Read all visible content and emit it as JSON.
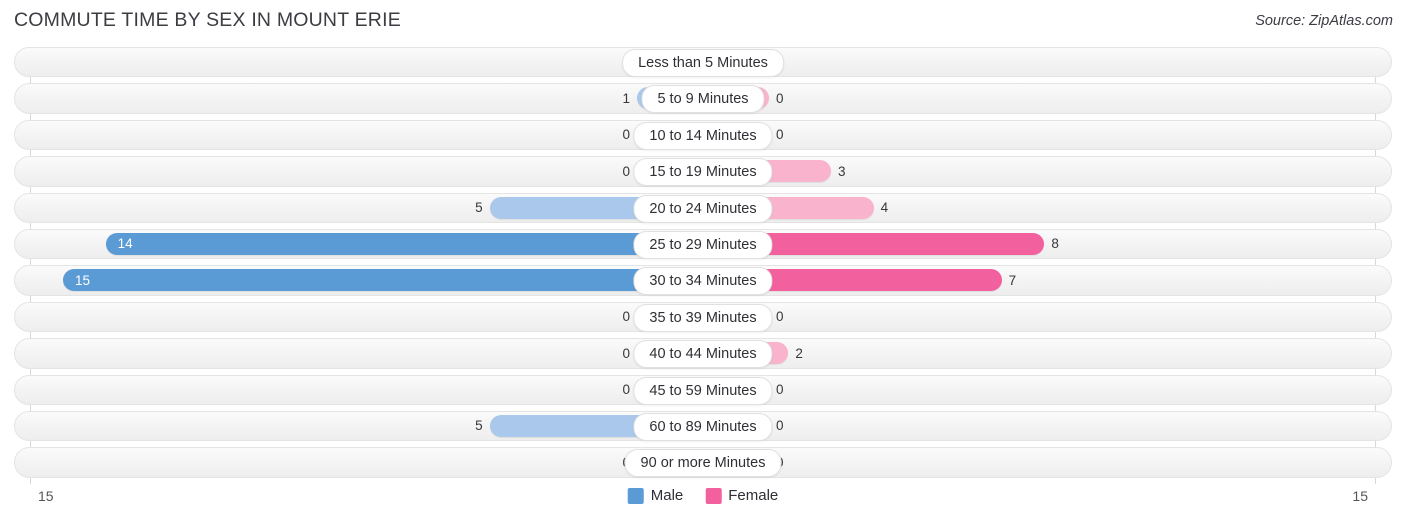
{
  "header": {
    "title": "COMMUTE TIME BY SEX IN MOUNT ERIE",
    "source": "Source: ZipAtlas.com"
  },
  "axis": {
    "left_label": "15",
    "right_label": "15"
  },
  "legend": [
    {
      "label": "Male",
      "color": "#5b9bd5"
    },
    {
      "label": "Female",
      "color": "#f2609e"
    }
  ],
  "colors": {
    "male_light": "#aac8ec",
    "male_dark": "#5b9bd5",
    "female_light": "#f9b3cd",
    "female_dark": "#f2609e",
    "track_bg": "#f4f4f4",
    "track_border": "#e4e4e4",
    "gridline": "#d8d8d8",
    "title": "#3c3c42"
  },
  "chart_data": {
    "type": "bar",
    "orientation": "horizontal-diverging",
    "title": "COMMUTE TIME BY SEX IN MOUNT ERIE",
    "xlabel": "",
    "ylabel": "",
    "xlim": [
      15,
      15
    ],
    "grid": true,
    "legend_position": "bottom-center",
    "categories": [
      "Less than 5 Minutes",
      "5 to 9 Minutes",
      "10 to 14 Minutes",
      "15 to 19 Minutes",
      "20 to 24 Minutes",
      "25 to 29 Minutes",
      "30 to 34 Minutes",
      "35 to 39 Minutes",
      "40 to 44 Minutes",
      "45 to 59 Minutes",
      "60 to 89 Minutes",
      "90 or more Minutes"
    ],
    "series": [
      {
        "name": "Male",
        "values": [
          0,
          1,
          0,
          0,
          5,
          14,
          15,
          0,
          0,
          0,
          5,
          0
        ]
      },
      {
        "name": "Female",
        "values": [
          0,
          0,
          0,
          3,
          4,
          8,
          7,
          0,
          2,
          0,
          0,
          0
        ]
      }
    ]
  },
  "rows": [
    {
      "category": "Less than 5 Minutes",
      "male": "0",
      "female": "0"
    },
    {
      "category": "5 to 9 Minutes",
      "male": "1",
      "female": "0"
    },
    {
      "category": "10 to 14 Minutes",
      "male": "0",
      "female": "0"
    },
    {
      "category": "15 to 19 Minutes",
      "male": "0",
      "female": "3"
    },
    {
      "category": "20 to 24 Minutes",
      "male": "5",
      "female": "4"
    },
    {
      "category": "25 to 29 Minutes",
      "male": "14",
      "female": "8"
    },
    {
      "category": "30 to 34 Minutes",
      "male": "15",
      "female": "7"
    },
    {
      "category": "35 to 39 Minutes",
      "male": "0",
      "female": "0"
    },
    {
      "category": "40 to 44 Minutes",
      "male": "0",
      "female": "2"
    },
    {
      "category": "45 to 59 Minutes",
      "male": "0",
      "female": "0"
    },
    {
      "category": "60 to 89 Minutes",
      "male": "5",
      "female": "0"
    },
    {
      "category": "90 or more Minutes",
      "male": "0",
      "female": "0"
    }
  ]
}
